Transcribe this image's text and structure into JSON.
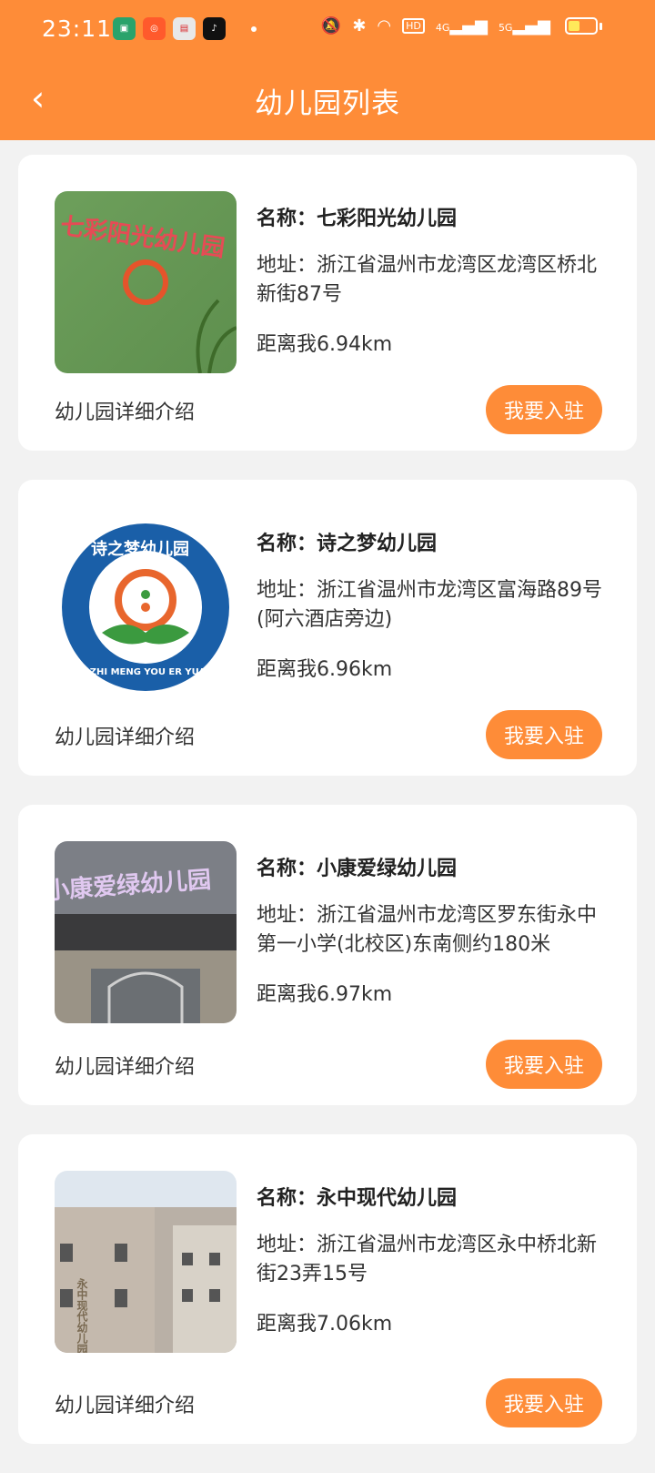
{
  "statusbar": {
    "time": "23:11",
    "net1": "4G",
    "net2": "5G"
  },
  "nav": {
    "title": "幼儿园列表"
  },
  "cards": [
    {
      "name": "名称：七彩阳光幼儿园",
      "address": "地址：浙江省温州市龙湾区龙湾区桥北新街87号",
      "distance": "距离我6.94km",
      "sign": "七彩阳光幼儿园",
      "detail": "幼儿园详细介绍",
      "action": "我要入驻"
    },
    {
      "name": "名称：诗之梦幼儿园",
      "address": "地址：浙江省温州市龙湾区富海路89号(阿六酒店旁边)",
      "distance": "距离我6.96km",
      "sign": "诗之梦幼儿园",
      "sign_sub": "SHI ZHI MENG YOU ER YUAN",
      "detail": "幼儿园详细介绍",
      "action": "我要入驻"
    },
    {
      "name": "名称：小康爱绿幼儿园",
      "address": "地址：浙江省温州市龙湾区罗东街永中第一小学(北校区)东南侧约180米",
      "distance": "距离我6.97km",
      "sign": "小康爱绿幼儿园",
      "detail": "幼儿园详细介绍",
      "action": "我要入驻"
    },
    {
      "name": "名称：永中现代幼儿园",
      "address": "地址：浙江省温州市龙湾区永中桥北新街23弄15号",
      "distance": "距离我7.06km",
      "sign": "永中现代幼儿园",
      "detail": "幼儿园详细介绍",
      "action": "我要入驻"
    }
  ],
  "colors": {
    "accent": "#fe8c38",
    "background": "#f2f2f2"
  }
}
